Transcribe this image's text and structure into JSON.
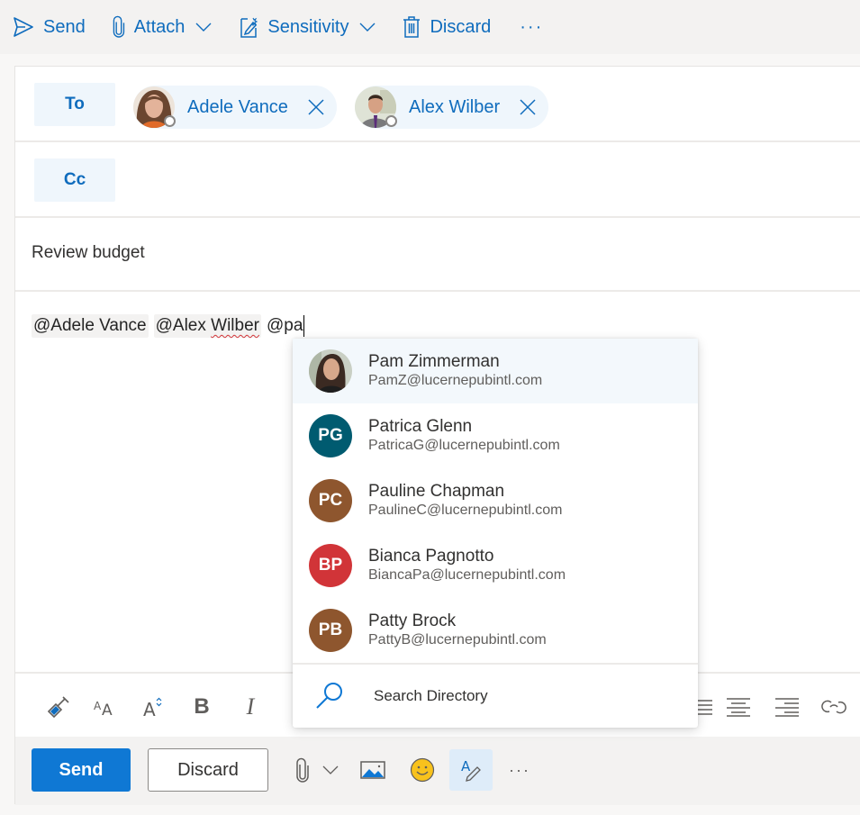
{
  "command_bar": {
    "send": {
      "label": "Send",
      "icon": "send-icon"
    },
    "attach": {
      "label": "Attach",
      "icon": "paperclip-icon"
    },
    "sensitivity": {
      "label": "Sensitivity",
      "icon": "sensitivity-icon"
    },
    "discard": {
      "label": "Discard",
      "icon": "trash-icon"
    },
    "more": {
      "label": "···",
      "icon": "more-icon"
    }
  },
  "compose": {
    "to_label": "To",
    "cc_label": "Cc",
    "to_recipients": [
      {
        "name": "Adele Vance",
        "presence": "offline"
      },
      {
        "name": "Alex Wilber",
        "presence": "offline"
      }
    ],
    "subject": "Review budget",
    "body": {
      "mentions": [
        "@Adele Vance",
        "@Alex ",
        "Wilber"
      ],
      "typing": "@pa"
    }
  },
  "mention_suggestions": {
    "items": [
      {
        "name": "Pam Zimmerman",
        "email": "PamZ@lucernepubintl.com",
        "initials": "",
        "color": "",
        "highlighted": true
      },
      {
        "name": "Patrica Glenn",
        "email": "PatricaG@lucernepubintl.com",
        "initials": "PG",
        "color": "#005b70"
      },
      {
        "name": "Pauline Chapman",
        "email": "PaulineC@lucernepubintl.com",
        "initials": "PC",
        "color": "#8e562e"
      },
      {
        "name": "Bianca Pagnotto",
        "email": "BiancaPa@lucernepubintl.com",
        "initials": "BP",
        "color": "#d13438"
      },
      {
        "name": "Patty Brock",
        "email": "PattyB@lucernepubintl.com",
        "initials": "PB",
        "color": "#8e562e"
      }
    ],
    "search_directory_label": "Search Directory"
  },
  "format_toolbar": {
    "icons": [
      "format-painter-icon",
      "font-size-icon",
      "grow-font-icon",
      "bold-icon",
      "italic-icon",
      "bullets-icon",
      "align-center-icon",
      "align-right-icon",
      "link-icon"
    ]
  },
  "action_bar": {
    "send_label": "Send",
    "discard_label": "Discard",
    "more_label": "···"
  },
  "colors": {
    "accent": "#0f6cbd",
    "send_button": "#0f78d4",
    "emoji": "#f8c21c"
  }
}
